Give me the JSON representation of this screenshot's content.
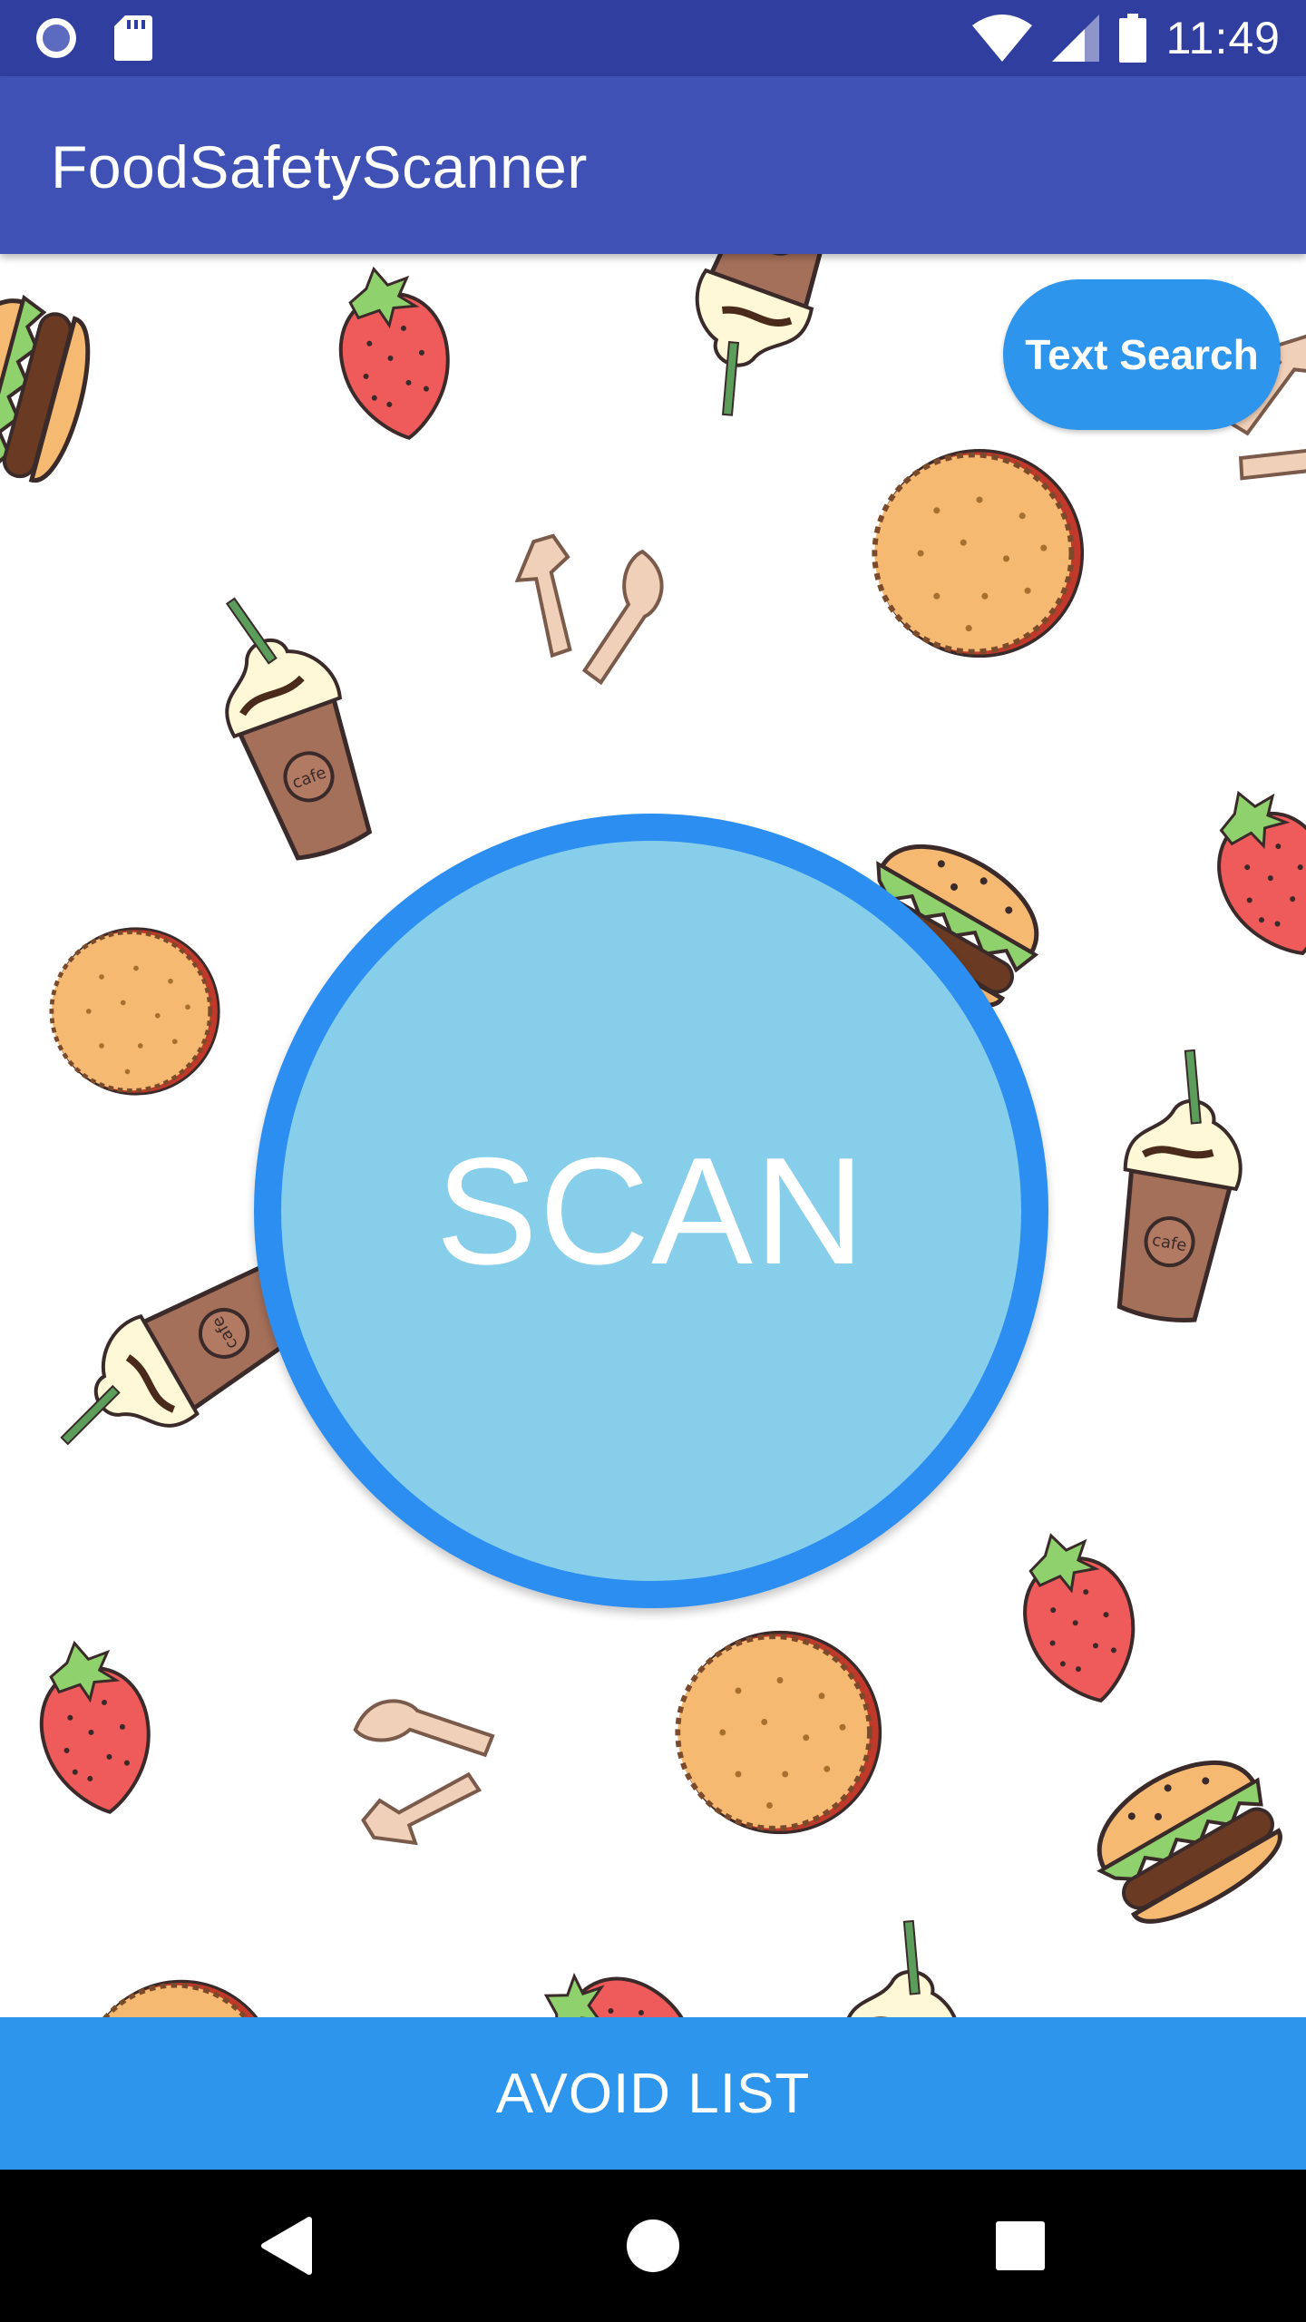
{
  "status_bar": {
    "time": "11:49",
    "icons": [
      "circle-notification-icon",
      "sd-card-icon",
      "wifi-icon",
      "cell-signal-icon",
      "battery-icon"
    ]
  },
  "app_bar": {
    "title": "FoodSafetyScanner"
  },
  "main": {
    "text_search_label": "Text Search",
    "scan_label": "SCAN",
    "background": "food-doodle-pattern"
  },
  "bottom": {
    "avoid_list_label": "AVOID LIST"
  },
  "nav_bar": {
    "icons": [
      "back-icon",
      "home-icon",
      "recents-icon"
    ]
  },
  "colors": {
    "status_bar": "#303f9f",
    "app_bar": "#3f51b5",
    "accent_button": "#2d95ec",
    "scan_fill": "#87ceeb",
    "scan_ring": "#2b8ef0"
  }
}
